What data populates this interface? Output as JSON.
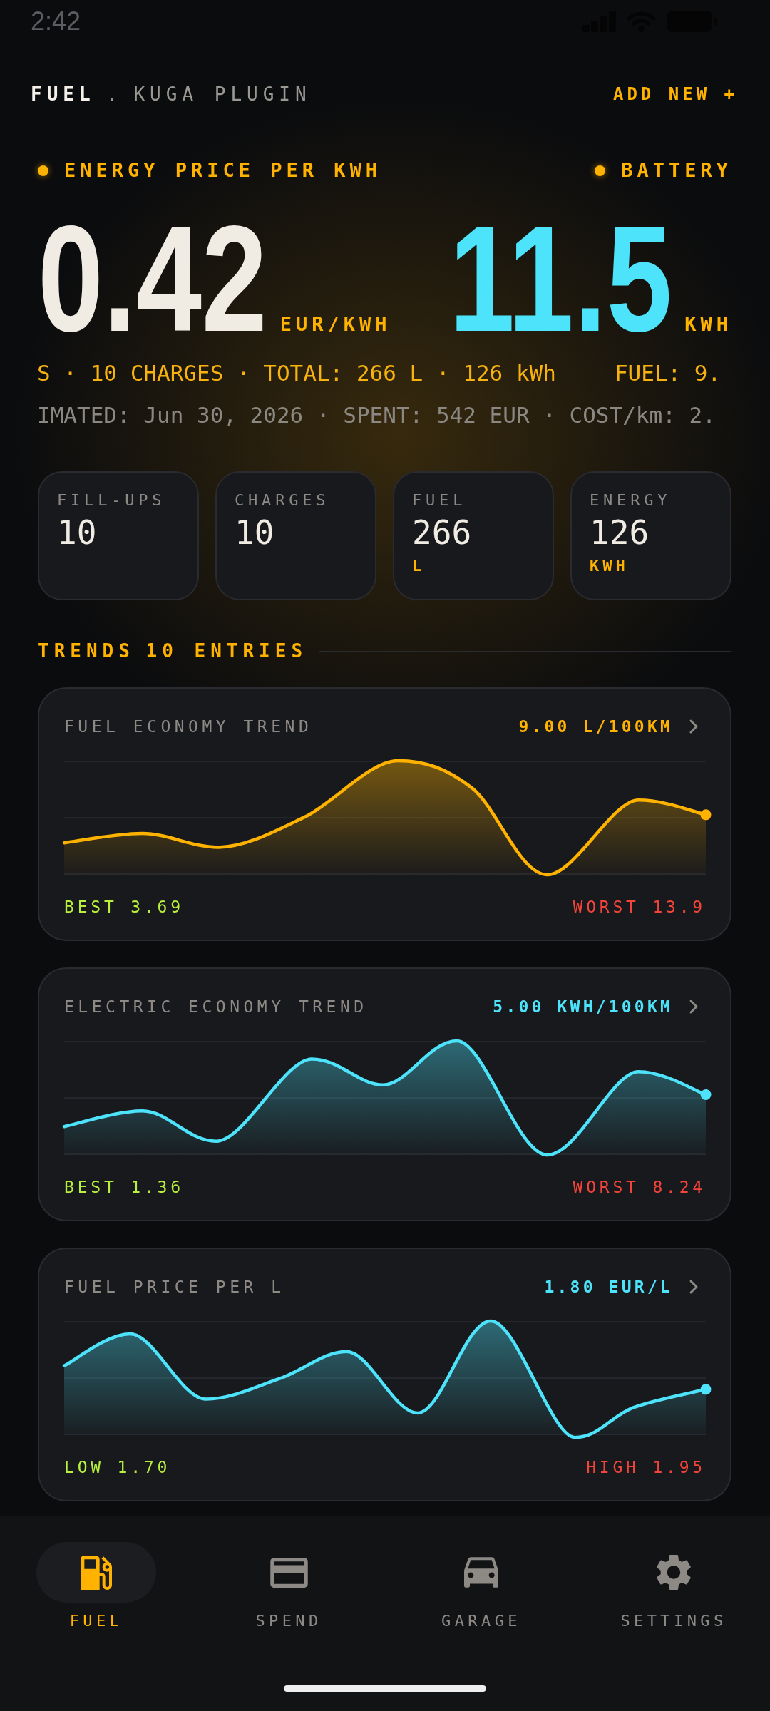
{
  "status_bar": {
    "time": "2:42"
  },
  "header": {
    "title": "FUEL",
    "separator": ".",
    "subtitle": "KUGA PLUGIN",
    "action": "ADD NEW +"
  },
  "hero": [
    {
      "label": "ENERGY PRICE PER KWH",
      "value": "0.42",
      "unit": "EUR/KWH",
      "color": "#f1ece3"
    },
    {
      "label": "BATTERY",
      "value": "11.5",
      "unit": "KWH",
      "color": "#4de3fb"
    }
  ],
  "tickers": [
    {
      "kind": "highlight",
      "segments": [
        "S · 10 CHARGES · TOTAL: 266 L · 126 kWh",
        "FUEL: 9."
      ]
    },
    {
      "kind": "muted",
      "segments": [
        "IMATED: Jun 30, 2026 · SPENT: 542 EUR · COST/km: 2."
      ]
    }
  ],
  "stats": [
    {
      "label": "FILL-UPS",
      "value": "10"
    },
    {
      "label": "CHARGES",
      "value": "10"
    },
    {
      "label": "FUEL",
      "value": "266",
      "unit": "L"
    },
    {
      "label": "ENERGY",
      "value": "126",
      "unit": "KWH"
    }
  ],
  "trends": {
    "title": "TRENDS",
    "count": "10 ENTRIES",
    "cards": [
      {
        "title": "FUEL ECONOMY TREND",
        "value": "9.00 L/100KM",
        "color": "#ffb300",
        "low": "BEST 3.69",
        "high": "WORST 13.9"
      },
      {
        "title": "ELECTRIC ECONOMY TREND",
        "value": "5.00 KWH/100KM",
        "color": "#4de3fb",
        "low": "BEST 1.36",
        "high": "WORST 8.24"
      },
      {
        "title": "FUEL PRICE PER L",
        "value": "1.80 EUR/L",
        "color": "#4de3fb",
        "low": "LOW 1.70",
        "high": "HIGH 1.95"
      }
    ]
  },
  "nav": [
    {
      "label": "FUEL",
      "selected": true
    },
    {
      "label": "SPEND",
      "selected": false
    },
    {
      "label": "GARAGE",
      "selected": false
    },
    {
      "label": "SETTINGS",
      "selected": false
    }
  ]
}
